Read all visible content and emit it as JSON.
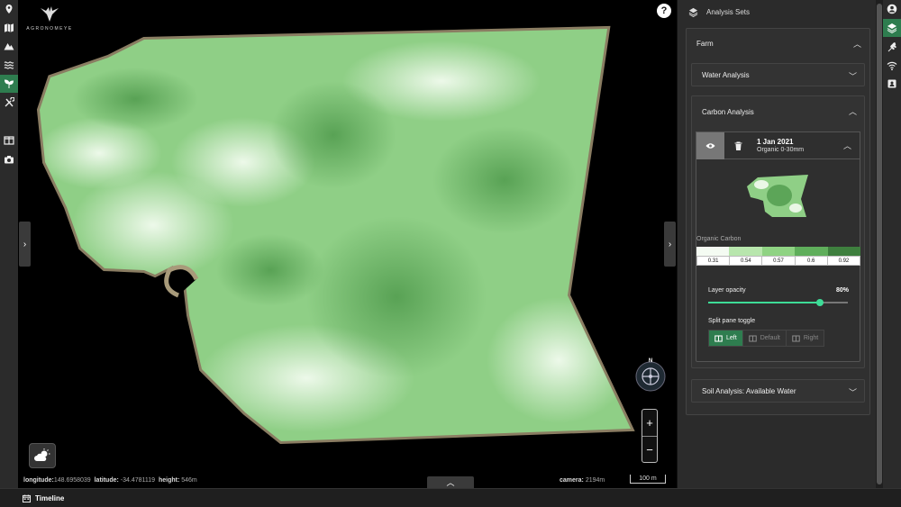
{
  "left_rail": {
    "items": [
      {
        "icon": "user-marker-icon",
        "active": false
      },
      {
        "icon": "map-icon",
        "active": false
      },
      {
        "icon": "mountain-icon",
        "active": false
      },
      {
        "icon": "water-waves-icon",
        "active": false
      },
      {
        "icon": "sprout-icon",
        "active": true
      },
      {
        "icon": "tools-icon",
        "active": false
      },
      {
        "icon": "split-view-icon",
        "active": false
      },
      {
        "icon": "camera-icon",
        "active": false
      }
    ]
  },
  "logo": {
    "brand": "AGRONOMEYE"
  },
  "map": {
    "help_label": "?",
    "compass_north": "N",
    "zoom_in": "+",
    "zoom_out": "−",
    "longitude_label": "longitude:",
    "longitude_value": "148.6958039",
    "latitude_label": "latitude:",
    "latitude_value": "-34.4781119",
    "height_label": "height:",
    "height_value": "546m",
    "camera_label": "camera:",
    "camera_value": "2194m",
    "scale_label": "100 m",
    "colors": {
      "field_light": "#e3f5dc",
      "field_mid": "#8fcf86",
      "field_dark": "#4f9a4c"
    }
  },
  "panel": {
    "header_title": "Analysis Sets",
    "farm": {
      "title": "Farm"
    },
    "water_analysis": {
      "title": "Water Analysis"
    },
    "carbon_analysis": {
      "title": "Carbon Analysis",
      "layer": {
        "date": "1 Jan 2021",
        "subtitle": "Organic 0-30mm",
        "legend_title": "Organic Carbon",
        "legend_values": [
          "0.31",
          "0.54",
          "0.57",
          "0.6",
          "0.92"
        ],
        "legend_colors": [
          "#f4fbf2",
          "#b8e6ad",
          "#8fd383",
          "#5fae5b",
          "#3e7f3e"
        ],
        "opacity_label": "Layer opacity",
        "opacity_value": "80%",
        "opacity_fraction": 0.8,
        "split_label": "Split pane toggle",
        "split_options": [
          "Left",
          "Default",
          "Right"
        ],
        "split_selected": "Left"
      }
    },
    "soil_analysis": {
      "title": "Soil Analysis: Available Water"
    }
  },
  "right_rail": {
    "items": [
      {
        "icon": "account-icon",
        "active": false
      },
      {
        "icon": "layers-icon",
        "active": true
      },
      {
        "icon": "wheat-icon",
        "active": false
      },
      {
        "icon": "wifi-signal-icon",
        "active": false
      },
      {
        "icon": "contacts-book-icon",
        "active": false
      }
    ]
  },
  "footer": {
    "timeline_label": "Timeline"
  },
  "accent": "#2e7d4f"
}
